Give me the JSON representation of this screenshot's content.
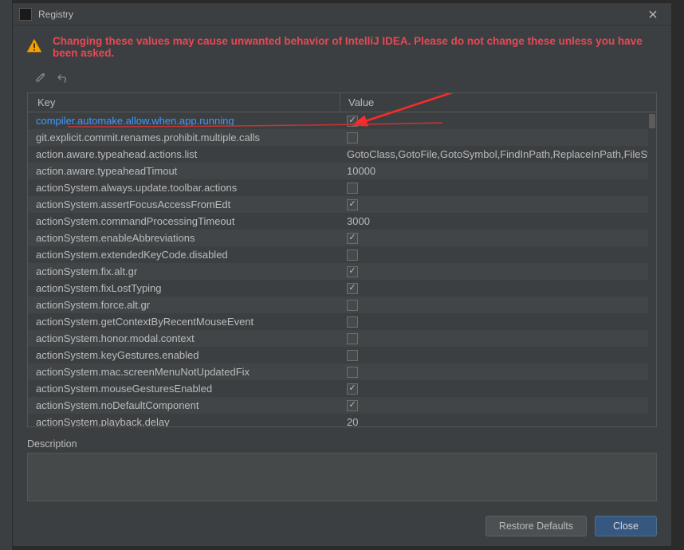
{
  "window": {
    "title": "Registry"
  },
  "warning": {
    "text": "Changing these values may cause unwanted behavior of IntelliJ IDEA. Please do not change these unless you have been asked."
  },
  "table": {
    "headers": {
      "key": "Key",
      "value": "Value"
    },
    "rows": [
      {
        "key": "compiler.automake.allow.when.app.running",
        "type": "bool",
        "checked": true,
        "highlight": true
      },
      {
        "key": "git.explicit.commit.renames.prohibit.multiple.calls",
        "type": "bool",
        "checked": false
      },
      {
        "key": "action.aware.typeahead.actions.list",
        "type": "text",
        "value": "GotoClass,GotoFile,GotoSymbol,FindInPath,ReplaceInPath,FileStruct"
      },
      {
        "key": "action.aware.typeaheadTimout",
        "type": "text",
        "value": "10000"
      },
      {
        "key": "actionSystem.always.update.toolbar.actions",
        "type": "bool",
        "checked": false
      },
      {
        "key": "actionSystem.assertFocusAccessFromEdt",
        "type": "bool",
        "checked": true
      },
      {
        "key": "actionSystem.commandProcessingTimeout",
        "type": "text",
        "value": "3000"
      },
      {
        "key": "actionSystem.enableAbbreviations",
        "type": "bool",
        "checked": true
      },
      {
        "key": "actionSystem.extendedKeyCode.disabled",
        "type": "bool",
        "checked": false
      },
      {
        "key": "actionSystem.fix.alt.gr",
        "type": "bool",
        "checked": true
      },
      {
        "key": "actionSystem.fixLostTyping",
        "type": "bool",
        "checked": true
      },
      {
        "key": "actionSystem.force.alt.gr",
        "type": "bool",
        "checked": false
      },
      {
        "key": "actionSystem.getContextByRecentMouseEvent",
        "type": "bool",
        "checked": false
      },
      {
        "key": "actionSystem.honor.modal.context",
        "type": "bool",
        "checked": false
      },
      {
        "key": "actionSystem.keyGestures.enabled",
        "type": "bool",
        "checked": false
      },
      {
        "key": "actionSystem.mac.screenMenuNotUpdatedFix",
        "type": "bool",
        "checked": false
      },
      {
        "key": "actionSystem.mouseGesturesEnabled",
        "type": "bool",
        "checked": true
      },
      {
        "key": "actionSystem.noDefaultComponent",
        "type": "bool",
        "checked": true
      },
      {
        "key": "actionSystem.playback.delay",
        "type": "text",
        "value": "20"
      }
    ]
  },
  "description": {
    "label": "Description"
  },
  "buttons": {
    "restore": "Restore Defaults",
    "close": "Close"
  }
}
